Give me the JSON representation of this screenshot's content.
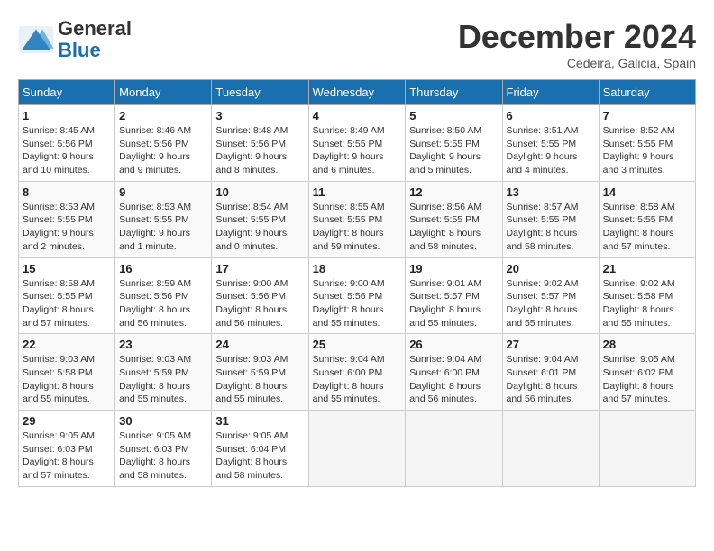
{
  "header": {
    "logo_line1": "General",
    "logo_line2": "Blue",
    "month": "December 2024",
    "location": "Cedeira, Galicia, Spain"
  },
  "columns": [
    "Sunday",
    "Monday",
    "Tuesday",
    "Wednesday",
    "Thursday",
    "Friday",
    "Saturday"
  ],
  "weeks": [
    [
      {
        "day": "1",
        "info": "Sunrise: 8:45 AM\nSunset: 5:56 PM\nDaylight: 9 hours\nand 10 minutes."
      },
      {
        "day": "2",
        "info": "Sunrise: 8:46 AM\nSunset: 5:56 PM\nDaylight: 9 hours\nand 9 minutes."
      },
      {
        "day": "3",
        "info": "Sunrise: 8:48 AM\nSunset: 5:56 PM\nDaylight: 9 hours\nand 8 minutes."
      },
      {
        "day": "4",
        "info": "Sunrise: 8:49 AM\nSunset: 5:55 PM\nDaylight: 9 hours\nand 6 minutes."
      },
      {
        "day": "5",
        "info": "Sunrise: 8:50 AM\nSunset: 5:55 PM\nDaylight: 9 hours\nand 5 minutes."
      },
      {
        "day": "6",
        "info": "Sunrise: 8:51 AM\nSunset: 5:55 PM\nDaylight: 9 hours\nand 4 minutes."
      },
      {
        "day": "7",
        "info": "Sunrise: 8:52 AM\nSunset: 5:55 PM\nDaylight: 9 hours\nand 3 minutes."
      }
    ],
    [
      {
        "day": "8",
        "info": "Sunrise: 8:53 AM\nSunset: 5:55 PM\nDaylight: 9 hours\nand 2 minutes."
      },
      {
        "day": "9",
        "info": "Sunrise: 8:53 AM\nSunset: 5:55 PM\nDaylight: 9 hours\nand 1 minute."
      },
      {
        "day": "10",
        "info": "Sunrise: 8:54 AM\nSunset: 5:55 PM\nDaylight: 9 hours\nand 0 minutes."
      },
      {
        "day": "11",
        "info": "Sunrise: 8:55 AM\nSunset: 5:55 PM\nDaylight: 8 hours\nand 59 minutes."
      },
      {
        "day": "12",
        "info": "Sunrise: 8:56 AM\nSunset: 5:55 PM\nDaylight: 8 hours\nand 58 minutes."
      },
      {
        "day": "13",
        "info": "Sunrise: 8:57 AM\nSunset: 5:55 PM\nDaylight: 8 hours\nand 58 minutes."
      },
      {
        "day": "14",
        "info": "Sunrise: 8:58 AM\nSunset: 5:55 PM\nDaylight: 8 hours\nand 57 minutes."
      }
    ],
    [
      {
        "day": "15",
        "info": "Sunrise: 8:58 AM\nSunset: 5:55 PM\nDaylight: 8 hours\nand 57 minutes."
      },
      {
        "day": "16",
        "info": "Sunrise: 8:59 AM\nSunset: 5:56 PM\nDaylight: 8 hours\nand 56 minutes."
      },
      {
        "day": "17",
        "info": "Sunrise: 9:00 AM\nSunset: 5:56 PM\nDaylight: 8 hours\nand 56 minutes."
      },
      {
        "day": "18",
        "info": "Sunrise: 9:00 AM\nSunset: 5:56 PM\nDaylight: 8 hours\nand 55 minutes."
      },
      {
        "day": "19",
        "info": "Sunrise: 9:01 AM\nSunset: 5:57 PM\nDaylight: 8 hours\nand 55 minutes."
      },
      {
        "day": "20",
        "info": "Sunrise: 9:02 AM\nSunset: 5:57 PM\nDaylight: 8 hours\nand 55 minutes."
      },
      {
        "day": "21",
        "info": "Sunrise: 9:02 AM\nSunset: 5:58 PM\nDaylight: 8 hours\nand 55 minutes."
      }
    ],
    [
      {
        "day": "22",
        "info": "Sunrise: 9:03 AM\nSunset: 5:58 PM\nDaylight: 8 hours\nand 55 minutes."
      },
      {
        "day": "23",
        "info": "Sunrise: 9:03 AM\nSunset: 5:59 PM\nDaylight: 8 hours\nand 55 minutes."
      },
      {
        "day": "24",
        "info": "Sunrise: 9:03 AM\nSunset: 5:59 PM\nDaylight: 8 hours\nand 55 minutes."
      },
      {
        "day": "25",
        "info": "Sunrise: 9:04 AM\nSunset: 6:00 PM\nDaylight: 8 hours\nand 55 minutes."
      },
      {
        "day": "26",
        "info": "Sunrise: 9:04 AM\nSunset: 6:00 PM\nDaylight: 8 hours\nand 56 minutes."
      },
      {
        "day": "27",
        "info": "Sunrise: 9:04 AM\nSunset: 6:01 PM\nDaylight: 8 hours\nand 56 minutes."
      },
      {
        "day": "28",
        "info": "Sunrise: 9:05 AM\nSunset: 6:02 PM\nDaylight: 8 hours\nand 57 minutes."
      }
    ],
    [
      {
        "day": "29",
        "info": "Sunrise: 9:05 AM\nSunset: 6:03 PM\nDaylight: 8 hours\nand 57 minutes."
      },
      {
        "day": "30",
        "info": "Sunrise: 9:05 AM\nSunset: 6:03 PM\nDaylight: 8 hours\nand 58 minutes."
      },
      {
        "day": "31",
        "info": "Sunrise: 9:05 AM\nSunset: 6:04 PM\nDaylight: 8 hours\nand 58 minutes."
      },
      null,
      null,
      null,
      null
    ]
  ]
}
